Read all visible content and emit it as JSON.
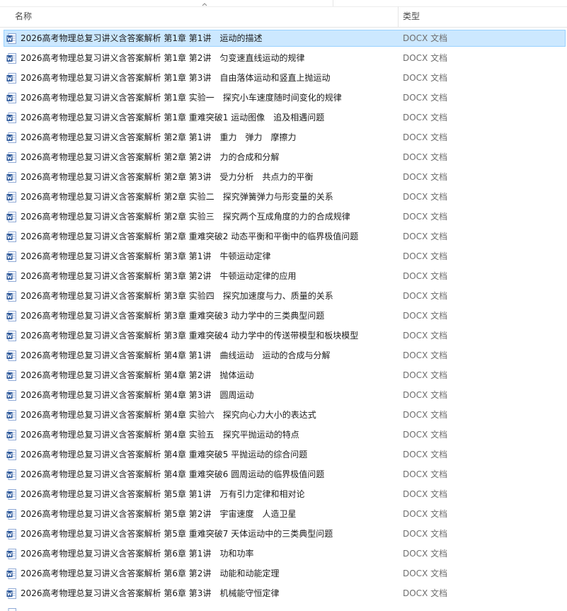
{
  "header": {
    "name_label": "名称",
    "type_label": "类型"
  },
  "icons": {
    "file": "word-document-icon",
    "sort": "sort-ascending-icon"
  },
  "colors": {
    "selection_fill": "#cce8ff",
    "selection_border": "#99d1ff",
    "word_blue": "#2b579a"
  },
  "files": [
    {
      "name": "2026高考物理总复习讲义含答案解析 第1章 第1讲　运动的描述",
      "type": "DOCX 文档",
      "selected": true
    },
    {
      "name": "2026高考物理总复习讲义含答案解析 第1章 第2讲　匀变速直线运动的规律",
      "type": "DOCX 文档"
    },
    {
      "name": "2026高考物理总复习讲义含答案解析 第1章 第3讲　自由落体运动和竖直上抛运动",
      "type": "DOCX 文档"
    },
    {
      "name": "2026高考物理总复习讲义含答案解析 第1章 实验一　探究小车速度随时间变化的规律",
      "type": "DOCX 文档"
    },
    {
      "name": "2026高考物理总复习讲义含答案解析 第1章 重难突破1 运动图像　追及相遇问题",
      "type": "DOCX 文档"
    },
    {
      "name": "2026高考物理总复习讲义含答案解析 第2章 第1讲　重力　弹力　摩擦力",
      "type": "DOCX 文档"
    },
    {
      "name": "2026高考物理总复习讲义含答案解析 第2章 第2讲　力的合成和分解",
      "type": "DOCX 文档"
    },
    {
      "name": "2026高考物理总复习讲义含答案解析 第2章 第3讲　受力分析　共点力的平衡",
      "type": "DOCX 文档"
    },
    {
      "name": "2026高考物理总复习讲义含答案解析 第2章 实验二　探究弹簧弹力与形变量的关系",
      "type": "DOCX 文档"
    },
    {
      "name": "2026高考物理总复习讲义含答案解析 第2章 实验三　探究两个互成角度的力的合成规律",
      "type": "DOCX 文档"
    },
    {
      "name": "2026高考物理总复习讲义含答案解析 第2章 重难突破2 动态平衡和平衡中的临界极值问题",
      "type": "DOCX 文档"
    },
    {
      "name": "2026高考物理总复习讲义含答案解析 第3章 第1讲　牛顿运动定律",
      "type": "DOCX 文档"
    },
    {
      "name": "2026高考物理总复习讲义含答案解析 第3章 第2讲　牛顿运动定律的应用",
      "type": "DOCX 文档"
    },
    {
      "name": "2026高考物理总复习讲义含答案解析 第3章 实验四　探究加速度与力、质量的关系",
      "type": "DOCX 文档"
    },
    {
      "name": "2026高考物理总复习讲义含答案解析 第3章 重难突破3 动力学中的三类典型问题",
      "type": "DOCX 文档"
    },
    {
      "name": "2026高考物理总复习讲义含答案解析 第3章 重难突破4 动力学中的传送带模型和板块模型",
      "type": "DOCX 文档"
    },
    {
      "name": "2026高考物理总复习讲义含答案解析 第4章 第1讲　曲线运动　运动的合成与分解",
      "type": "DOCX 文档"
    },
    {
      "name": "2026高考物理总复习讲义含答案解析 第4章 第2讲　抛体运动",
      "type": "DOCX 文档"
    },
    {
      "name": "2026高考物理总复习讲义含答案解析 第4章 第3讲　圆周运动",
      "type": "DOCX 文档"
    },
    {
      "name": "2026高考物理总复习讲义含答案解析 第4章 实验六　探究向心力大小的表达式",
      "type": "DOCX 文档"
    },
    {
      "name": "2026高考物理总复习讲义含答案解析 第4章 实验五　探究平抛运动的特点",
      "type": "DOCX 文档"
    },
    {
      "name": "2026高考物理总复习讲义含答案解析 第4章 重难突破5 平抛运动的综合问题",
      "type": "DOCX 文档"
    },
    {
      "name": "2026高考物理总复习讲义含答案解析 第4章 重难突破6 圆周运动的临界极值问题",
      "type": "DOCX 文档"
    },
    {
      "name": "2026高考物理总复习讲义含答案解析 第5章 第1讲　万有引力定律和相对论",
      "type": "DOCX 文档"
    },
    {
      "name": "2026高考物理总复习讲义含答案解析 第5章 第2讲　宇宙速度　人造卫星",
      "type": "DOCX 文档"
    },
    {
      "name": "2026高考物理总复习讲义含答案解析 第5章 重难突破7 天体运动中的三类典型问题",
      "type": "DOCX 文档"
    },
    {
      "name": "2026高考物理总复习讲义含答案解析 第6章 第1讲　功和功率",
      "type": "DOCX 文档"
    },
    {
      "name": "2026高考物理总复习讲义含答案解析 第6章 第2讲　动能和动能定理",
      "type": "DOCX 文档"
    },
    {
      "name": "2026高考物理总复习讲义含答案解析 第6章 第3讲　机械能守恒定律",
      "type": "DOCX 文档"
    }
  ]
}
